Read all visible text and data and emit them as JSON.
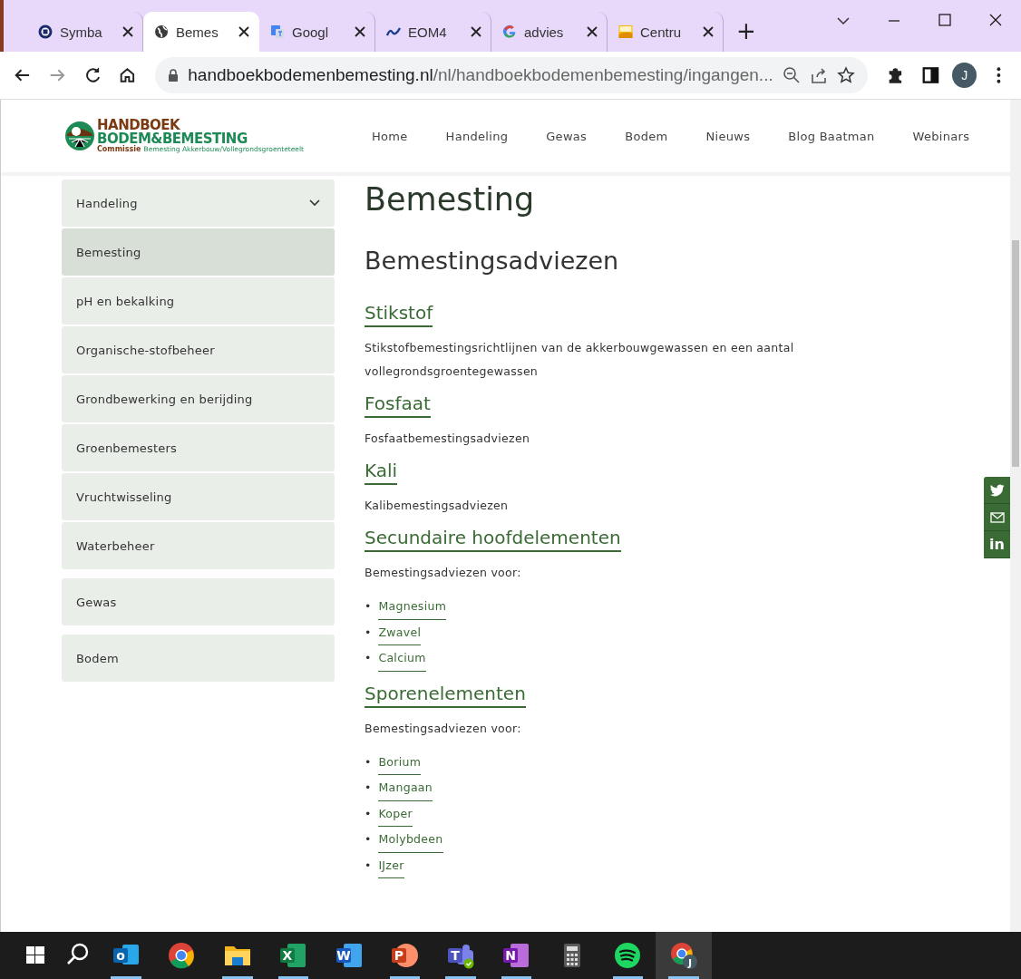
{
  "browser": {
    "tabs": [
      {
        "title": "Symba",
        "selected": false
      },
      {
        "title": "Bemes",
        "selected": true
      },
      {
        "title": "Googl",
        "selected": false
      },
      {
        "title": "EOM4",
        "selected": false
      },
      {
        "title": "advies",
        "selected": false
      },
      {
        "title": "Centru",
        "selected": false
      }
    ],
    "new_tab": "+",
    "url_domain": "handboekbodemenbemesting.nl",
    "url_path": "/nl/handboekbodemenbemesting/ingangen...",
    "avatar": "J"
  },
  "site": {
    "logo": {
      "line_1": "HANDBOEK",
      "line_2": "BODEM&BEMESTING",
      "line_3": "Commissie",
      "tagline": "Bemesting Akkerbouw/Vollegrondsgroenteteelt"
    },
    "nav": [
      "Home",
      "Handeling",
      "Gewas",
      "Bodem",
      "Nieuws",
      "Blog Baatman",
      "Webinars"
    ],
    "sidebar": [
      {
        "label": "Handeling",
        "expanded": true,
        "children": [
          {
            "label": "Bemesting",
            "selected": true
          },
          {
            "label": "pH en bekalking",
            "selected": false
          },
          {
            "label": "Organische-stofbeheer",
            "selected": false
          },
          {
            "label": "Grondbewerking en berijding",
            "selected": false
          },
          {
            "label": "Groenbemesters",
            "selected": false
          },
          {
            "label": "Vruchtwisseling",
            "selected": false
          },
          {
            "label": "Waterbeheer",
            "selected": false
          }
        ]
      },
      {
        "label": "Gewas"
      },
      {
        "label": "Bodem"
      }
    ],
    "title": "Bemesting",
    "subtitle": "Bemestingsadviezen",
    "sections": [
      {
        "heading": "Stikstof",
        "text": "Stikstofbemestingsrichtlijnen van de akkerbouwgewassen en een aantal vollegrondsgroentegewassen"
      },
      {
        "heading": "Fosfaat",
        "text": "Fosfaatbemestingsadviezen"
      },
      {
        "heading": "Kali",
        "text": "Kalibemestingsadviezen"
      },
      {
        "heading": "Secundaire hoofdelementen",
        "text": "Bemestingsadviezen voor:",
        "links": [
          {
            "bullet": "•",
            "label": "Magnesium"
          },
          {
            "bullet": "•",
            "label": "Zwavel"
          },
          {
            "bullet": "•",
            "label": "Calcium"
          }
        ]
      },
      {
        "heading": "Sporenelementen",
        "text": "Bemestingsadviezen voor:",
        "links": [
          {
            "bullet": "•",
            "label": "Borium"
          },
          {
            "bullet": "•",
            "label": "Mangaan"
          },
          {
            "bullet": "•",
            "label": "Koper"
          },
          {
            "bullet": "•",
            "label": "Molybdeen"
          },
          {
            "bullet": "•",
            "label": "IJzer"
          }
        ]
      }
    ],
    "share": {
      "linkedin": "in"
    }
  },
  "taskbar": {
    "apps": [
      {
        "kind": "outlook",
        "letter": "o",
        "running": true,
        "active": false
      },
      {
        "kind": "chrome",
        "running": false,
        "active": false
      },
      {
        "kind": "explorer",
        "running": true,
        "active": false
      },
      {
        "kind": "excel",
        "letter": "X",
        "running": true,
        "active": false
      },
      {
        "kind": "word",
        "letter": "W",
        "running": false,
        "active": false
      },
      {
        "kind": "powerpoint",
        "letter": "P",
        "running": true,
        "active": false
      },
      {
        "kind": "teams",
        "letter": "T",
        "running": true,
        "active": false
      },
      {
        "kind": "onenote",
        "letter": "N",
        "running": true,
        "active": false
      },
      {
        "kind": "calculator",
        "running": false,
        "active": false
      },
      {
        "kind": "spotify",
        "running": true,
        "active": false
      },
      {
        "kind": "chrome-profile",
        "letter": "J",
        "running": true,
        "active": true
      }
    ]
  }
}
